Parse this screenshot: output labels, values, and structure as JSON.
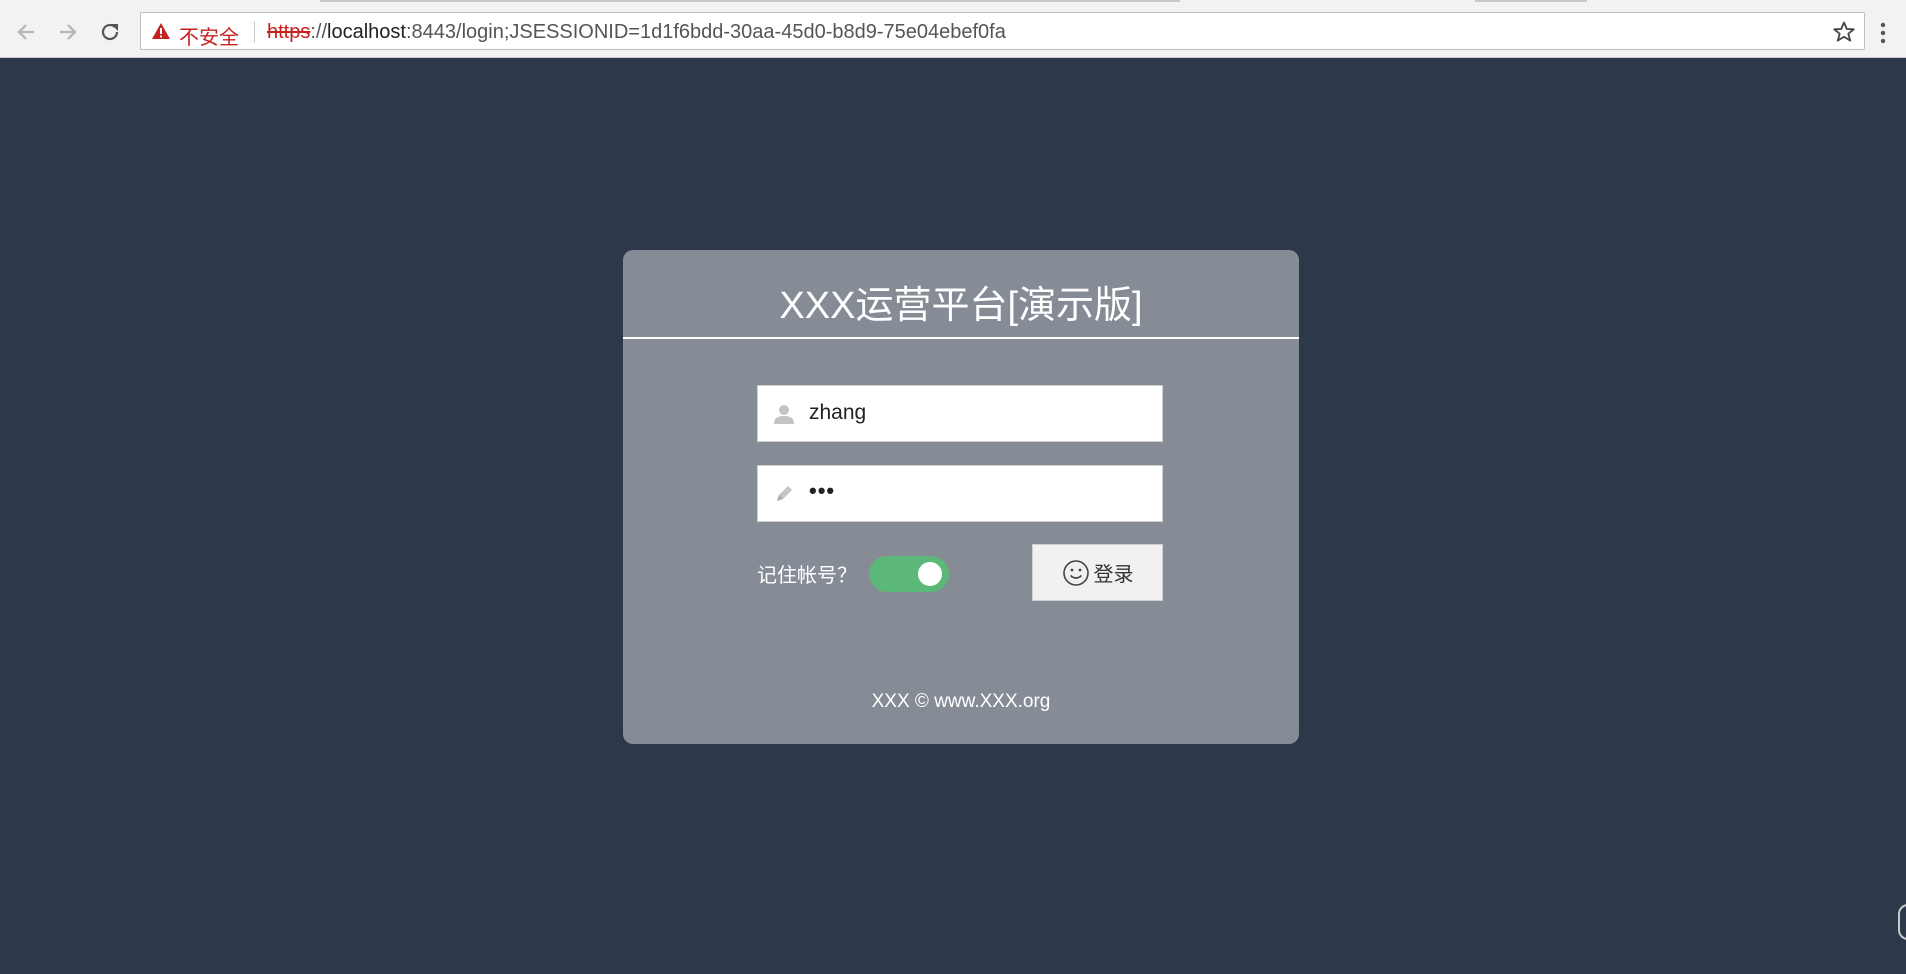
{
  "browser": {
    "security_label": "不安全",
    "url_scheme": "https",
    "url_separator": "://",
    "url_host": "localhost",
    "url_rest": ":8443/login;JSESSIONID=1d1f6bdd-30aa-45d0-b8d9-75e04ebef0fa"
  },
  "login": {
    "title": "XXX运营平台[演示版]",
    "username_value": "zhang",
    "password_value": "•••",
    "remember_label": "记住帐号？",
    "remember_enabled": true,
    "submit_label": "登录",
    "footer": "XXX © www.XXX.org"
  },
  "colors": {
    "page_background": "#2d394b",
    "card_background": "#858c96",
    "toggle_on": "#5cb879",
    "warning": "#c5221f"
  }
}
